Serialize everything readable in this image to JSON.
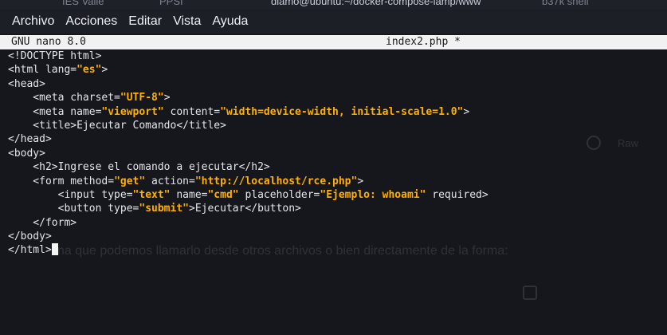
{
  "background_text": {
    "tab_left": "IES Valle",
    "tab_middle": "PPSI",
    "tab_title": "diamo@ubuntu:~/docker-compose-lamp/www",
    "tab_right": "b37k shell",
    "paragraph": "na que podemos llamarlo desde otros archivos o bien directamente de la forma:",
    "side_label": "Raw"
  },
  "menu": {
    "items": [
      "Archivo",
      "Acciones",
      "Editar",
      "Vista",
      "Ayuda"
    ]
  },
  "nano": {
    "version": "GNU nano 8.0",
    "filename": "index2.php *"
  },
  "editor": {
    "lines": [
      [
        {
          "t": "<!DOCTYPE html>"
        }
      ],
      [
        {
          "t": "<html lang="
        },
        {
          "t": "\"es\"",
          "s": 1
        },
        {
          "t": ">"
        }
      ],
      [
        {
          "t": "<head>"
        }
      ],
      [
        {
          "t": "    <meta charset="
        },
        {
          "t": "\"UTF-8\"",
          "s": 1
        },
        {
          "t": ">"
        }
      ],
      [
        {
          "t": "    <meta name="
        },
        {
          "t": "\"viewport\"",
          "s": 1
        },
        {
          "t": " content="
        },
        {
          "t": "\"width=device-width, initial-scale=1.0\"",
          "s": 1
        },
        {
          "t": ">"
        }
      ],
      [
        {
          "t": "    <title>Ejecutar Comando</title>"
        }
      ],
      [
        {
          "t": "</head>"
        }
      ],
      [
        {
          "t": "<body>"
        }
      ],
      [
        {
          "t": "    <h2>Ingrese el comando a ejecutar</h2>"
        }
      ],
      [
        {
          "t": "    <form method="
        },
        {
          "t": "\"get\"",
          "s": 1
        },
        {
          "t": " action="
        },
        {
          "t": "\"http://localhost/rce.php\"",
          "s": 1
        },
        {
          "t": ">"
        }
      ],
      [
        {
          "t": "        <input type="
        },
        {
          "t": "\"text\"",
          "s": 1
        },
        {
          "t": " name="
        },
        {
          "t": "\"cmd\"",
          "s": 1
        },
        {
          "t": " placeholder="
        },
        {
          "t": "\"Ejemplo: whoami\"",
          "s": 1
        },
        {
          "t": " required>"
        }
      ],
      [
        {
          "t": "        <button type="
        },
        {
          "t": "\"submit\"",
          "s": 1
        },
        {
          "t": ">Ejecutar</button>"
        }
      ],
      [
        {
          "t": "    </form>"
        }
      ],
      [
        {
          "t": "</body>"
        }
      ],
      [
        {
          "t": "</html>"
        }
      ]
    ]
  }
}
